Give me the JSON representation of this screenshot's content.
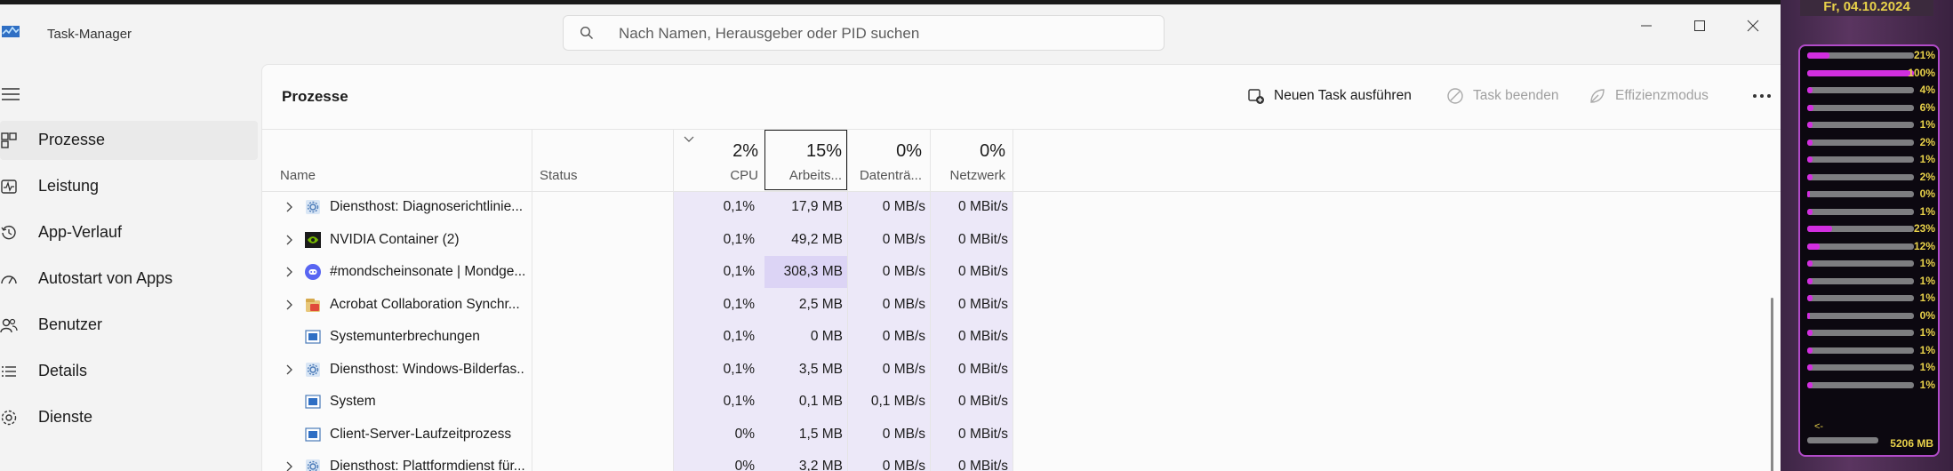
{
  "window": {
    "title": "Task-Manager"
  },
  "search": {
    "placeholder": "Nach Namen, Herausgeber oder PID suchen"
  },
  "sidebar": {
    "items": [
      {
        "label": "Prozesse",
        "icon": "processes-icon",
        "active": true
      },
      {
        "label": "Leistung",
        "icon": "performance-icon"
      },
      {
        "label": "App-Verlauf",
        "icon": "history-icon"
      },
      {
        "label": "Autostart von Apps",
        "icon": "startup-icon"
      },
      {
        "label": "Benutzer",
        "icon": "users-icon"
      },
      {
        "label": "Details",
        "icon": "details-icon"
      },
      {
        "label": "Dienste",
        "icon": "services-icon"
      }
    ]
  },
  "main": {
    "title": "Prozesse",
    "toolbar": {
      "new_task": "Neuen Task ausführen",
      "end_task": "Task beenden",
      "efficiency": "Effizienzmodus"
    },
    "columns": {
      "name": "Name",
      "status": "Status",
      "cpu": {
        "pct": "2%",
        "label": "CPU"
      },
      "mem": {
        "pct": "15%",
        "label": "Arbeits..."
      },
      "disk": {
        "pct": "0%",
        "label": "Datenträ..."
      },
      "net": {
        "pct": "0%",
        "label": "Netzwerk"
      }
    },
    "rows": [
      {
        "name": "Diensthost: Diagnoserichtlinie...",
        "icon": "gear-icon",
        "expand": true,
        "cpu": "0,1%",
        "mem": "17,9 MB",
        "disk": "0 MB/s",
        "net": "0 MBit/s"
      },
      {
        "name": "NVIDIA Container (2)",
        "icon": "nvidia-icon",
        "expand": true,
        "cpu": "0,1%",
        "mem": "49,2 MB",
        "disk": "0 MB/s",
        "net": "0 MBit/s"
      },
      {
        "name": "#mondscheinsonate | Mondge...",
        "icon": "discord-icon",
        "expand": true,
        "cpu": "0,1%",
        "mem": "308,3 MB",
        "disk": "0 MB/s",
        "net": "0 MBit/s"
      },
      {
        "name": "Acrobat Collaboration Synchr...",
        "icon": "acrobat-icon",
        "expand": true,
        "cpu": "0,1%",
        "mem": "2,5 MB",
        "disk": "0 MB/s",
        "net": "0 MBit/s"
      },
      {
        "name": "Systemunterbrechungen",
        "icon": "system-icon",
        "expand": false,
        "cpu": "0,1%",
        "mem": "0 MB",
        "disk": "0 MB/s",
        "net": "0 MBit/s"
      },
      {
        "name": "Diensthost: Windows-Bilderfas...",
        "icon": "gear-icon",
        "expand": true,
        "cpu": "0,1%",
        "mem": "3,5 MB",
        "disk": "0 MB/s",
        "net": "0 MBit/s"
      },
      {
        "name": "System",
        "icon": "system-icon",
        "expand": false,
        "cpu": "0,1%",
        "mem": "0,1 MB",
        "disk": "0,1 MB/s",
        "net": "0 MBit/s"
      },
      {
        "name": "Client-Server-Laufzeitprozess",
        "icon": "system-icon",
        "expand": false,
        "cpu": "0%",
        "mem": "1,5 MB",
        "disk": "0 MB/s",
        "net": "0 MBit/s"
      },
      {
        "name": "Diensthost: Plattformdienst für...",
        "icon": "gear-icon",
        "expand": true,
        "cpu": "0%",
        "mem": "3,2 MB",
        "disk": "0 MB/s",
        "net": "0 MBit/s"
      }
    ]
  },
  "gadget": {
    "date": "Fr, 04.10.2024",
    "values": [
      {
        "label": "21%",
        "level": 0.21
      },
      {
        "label": "100%",
        "level": 1.0
      },
      {
        "label": "4%",
        "level": 0.04
      },
      {
        "label": "6%",
        "level": 0.06
      },
      {
        "label": "1%",
        "level": 0.01
      },
      {
        "label": "2%",
        "level": 0.02
      },
      {
        "label": "1%",
        "level": 0.01
      },
      {
        "label": "2%",
        "level": 0.02
      },
      {
        "label": "0%",
        "level": 0.0
      },
      {
        "label": "1%",
        "level": 0.01
      },
      {
        "label": "23%",
        "level": 0.23
      },
      {
        "label": "12%",
        "level": 0.12
      },
      {
        "label": "1%",
        "level": 0.01
      },
      {
        "label": "1%",
        "level": 0.01
      },
      {
        "label": "1%",
        "level": 0.01
      },
      {
        "label": "0%",
        "level": 0.0
      },
      {
        "label": "1%",
        "level": 0.01
      },
      {
        "label": "1%",
        "level": 0.01
      },
      {
        "label": "1%",
        "level": 0.01
      },
      {
        "label": "1%",
        "level": 0.01
      }
    ],
    "memory": "5206 MB",
    "arrow": "<-"
  },
  "colors": {
    "accent_column": "#ece8f8",
    "highlight": "#dcd4f5",
    "gadget_text": "#e9d24a",
    "gadget_bar": "#d22ee0"
  }
}
